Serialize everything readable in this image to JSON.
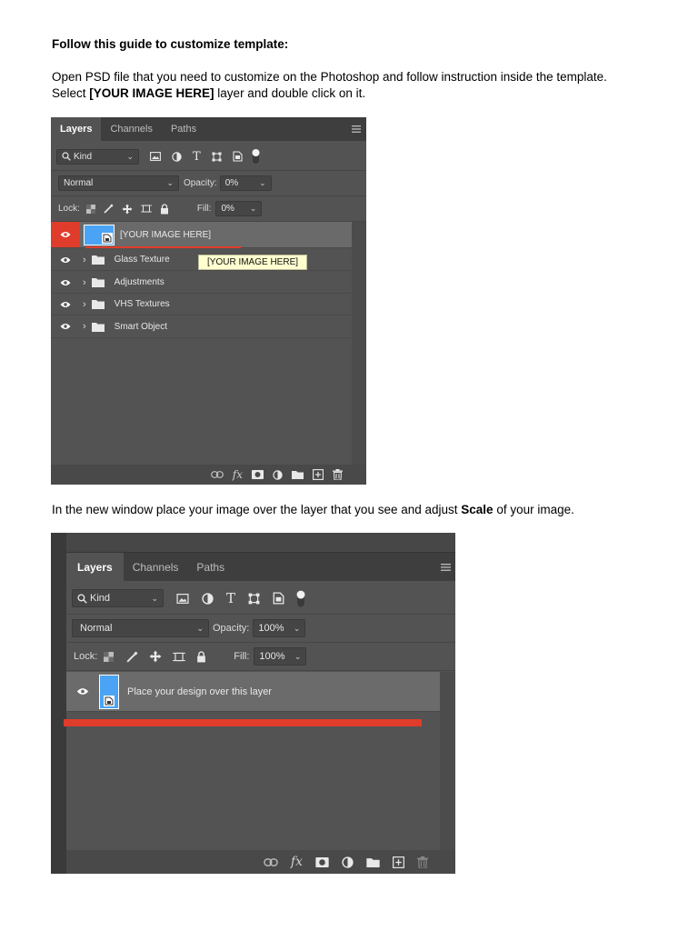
{
  "doc": {
    "heading": "Follow this guide to customize template:",
    "para1": {
      "pre": "Open PSD file that you need to customize on the Photoshop and follow instruction inside the template. Select ",
      "bold": "[YOUR IMAGE HERE]",
      "post": " layer and double click on it."
    },
    "para2": {
      "pre": "In the new window place your image over the layer that you see and adjust ",
      "bold": "Scale",
      "post": " of your image."
    }
  },
  "panel1": {
    "tabs": [
      "Layers",
      "Channels",
      "Paths"
    ],
    "filter_label": "Kind",
    "blend_mode": "Normal",
    "opacity_label": "Opacity:",
    "opacity_value": "0%",
    "lock_label": "Lock:",
    "fill_label": "Fill:",
    "fill_value": "0%",
    "layers": [
      {
        "name": "[YOUR IMAGE HERE]",
        "type": "smart-object",
        "selected": true
      },
      {
        "name": "Glass Texture",
        "type": "group"
      },
      {
        "name": "Adjustments",
        "type": "group"
      },
      {
        "name": "VHS Textures",
        "type": "group"
      },
      {
        "name": "Smart Object",
        "type": "group"
      }
    ],
    "tooltip": "[YOUR IMAGE HERE]"
  },
  "panel2": {
    "tabs": [
      "Layers",
      "Channels",
      "Paths"
    ],
    "filter_label": "Kind",
    "blend_mode": "Normal",
    "opacity_label": "Opacity:",
    "opacity_value": "100%",
    "lock_label": "Lock:",
    "fill_label": "Fill:",
    "fill_value": "100%",
    "layers": [
      {
        "name": "Place your design over this layer",
        "type": "smart-object",
        "selected": true
      }
    ]
  },
  "colors": {
    "panel_bg": "#535353",
    "tab_bar": "#3e3e3e",
    "selected_row": "#6b6b6b",
    "accent_red": "#e03c2c",
    "thumb_blue": "#4aa3f5",
    "tooltip_bg": "#ffffcf"
  }
}
